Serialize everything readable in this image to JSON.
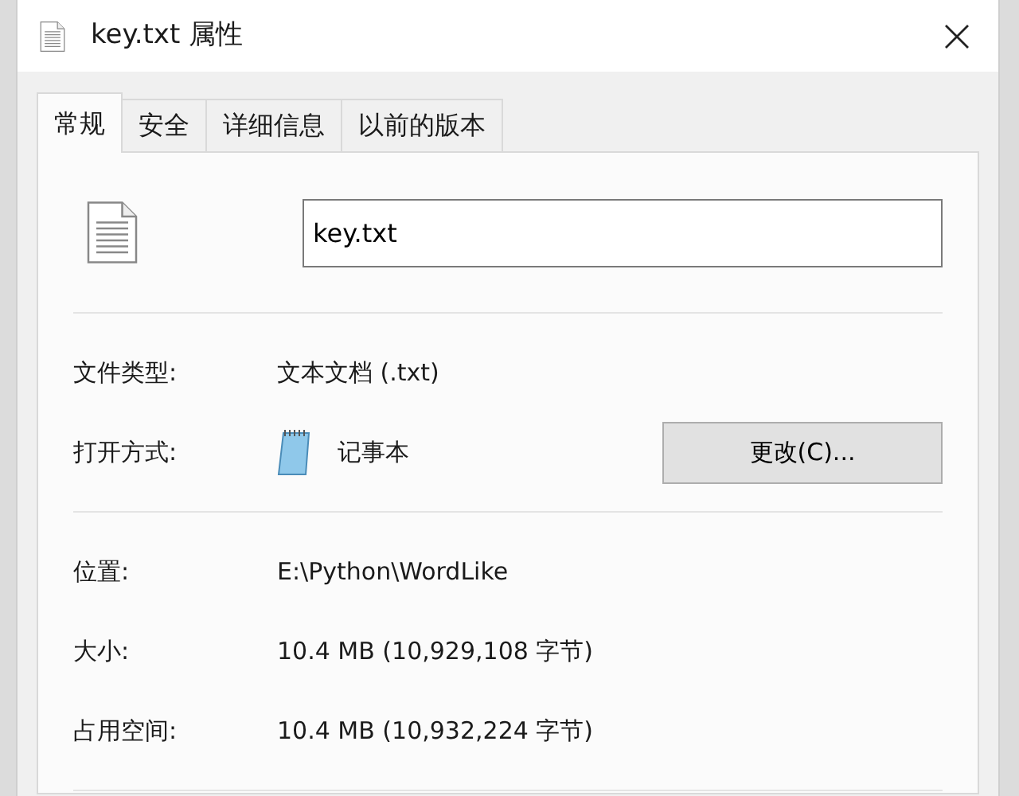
{
  "window": {
    "title": "key.txt 属性"
  },
  "tabs": [
    {
      "label": "常规",
      "selected": true
    },
    {
      "label": "安全",
      "selected": false
    },
    {
      "label": "详细信息",
      "selected": false
    },
    {
      "label": "以前的版本",
      "selected": false
    }
  ],
  "name_field": {
    "value": "key.txt"
  },
  "groups": [
    [
      {
        "kind": "text",
        "label": "文件类型:",
        "value": "文本文档 (.txt)"
      },
      {
        "kind": "app",
        "label": "打开方式:",
        "value": "记事本",
        "button": "更改(C)..."
      }
    ],
    [
      {
        "kind": "text",
        "label": "位置:",
        "value": "E:\\Python\\WordLike"
      },
      {
        "kind": "text",
        "label": "大小:",
        "value": "10.4 MB (10,929,108 字节)"
      },
      {
        "kind": "text",
        "label": "占用空间:",
        "value": "10.4 MB (10,932,224 字节)"
      }
    ]
  ]
}
